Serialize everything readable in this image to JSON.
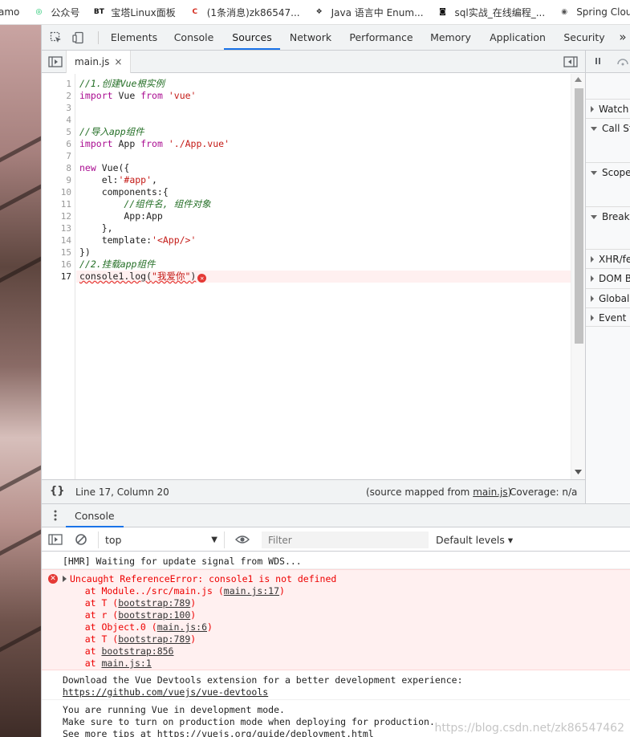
{
  "bookmarks": [
    {
      "label": "amo",
      "icon": "none",
      "icon_text": ""
    },
    {
      "label": "公众号",
      "icon": "wechat-icon",
      "icon_text": "◎",
      "icon_color": "#07c160"
    },
    {
      "label": "宝塔Linux面板",
      "icon": "bt-icon",
      "icon_text": "BT",
      "icon_color": "#111111"
    },
    {
      "label": "(1条消息)zk86547...",
      "icon": "csdn-icon",
      "icon_text": "C",
      "icon_color": "#d42b1e"
    },
    {
      "label": "Java 语言中 Enum...",
      "icon": "site-icon",
      "icon_text": "❖",
      "icon_color": "#333333"
    },
    {
      "label": "sql实战_在线编程_...",
      "icon": "nowcoder-icon",
      "icon_text": "◙",
      "icon_color": "#111111"
    },
    {
      "label": "Spring Clou",
      "icon": "globe-icon",
      "icon_text": "◉",
      "icon_color": "#555555"
    }
  ],
  "devtools": {
    "tabs": [
      "Elements",
      "Console",
      "Sources",
      "Network",
      "Performance",
      "Memory",
      "Application",
      "Security"
    ],
    "active_tab": "Sources",
    "more_tabs": "»"
  },
  "editor": {
    "file_tab": "main.js",
    "close_glyph": "×",
    "line_numbers": [
      "1",
      "2",
      "3",
      "4",
      "5",
      "6",
      "7",
      "8",
      "9",
      "10",
      "11",
      "12",
      "13",
      "14",
      "15",
      "16",
      "17"
    ],
    "current_line": "17",
    "code": {
      "l1": "//1.创建Vue根实例",
      "l2_kw": "import",
      "l2_id": "Vue",
      "l2_from": "from",
      "l2_str": "'vue'",
      "l5": "//导入app组件",
      "l6_kw": "import",
      "l6_id": "App",
      "l6_from": "from",
      "l6_str": "'./App.vue'",
      "l8_kw": "new",
      "l8_rest": "Vue({",
      "l9_key": "    el:",
      "l9_str": "'#app'",
      "l9_end": ",",
      "l10": "    components:{",
      "l11": "        //组件名, 组件对象",
      "l12": "        App:App",
      "l13": "    },",
      "l14_key": "    template:",
      "l14_str": "'<App/>'",
      "l15": "})",
      "l16": "//2.挂载app组件",
      "l17_a": "console1.log(",
      "l17_str": "\"我爱你\"",
      "l17_b": ")"
    }
  },
  "status": {
    "cursor": "Line 17, Column 20",
    "source_mapped_prefix": "(source mapped from ",
    "source_mapped_link": "main.js",
    "source_mapped_suffix": ")",
    "coverage": "Coverage: n/a"
  },
  "debugger": {
    "sections": [
      "Watch",
      "Call Sta",
      "Scope",
      "Breakp",
      "XHR/fe",
      "DOM B",
      "Global",
      "Event L"
    ]
  },
  "drawer": {
    "tab": "Console",
    "context": "top",
    "filter_placeholder": "Filter",
    "levels": "Default levels ▾"
  },
  "console": {
    "hmr": "[HMR] Waiting for update signal from WDS...",
    "error_title": "Uncaught ReferenceError: console1 is not defined",
    "stack": [
      {
        "prefix": "    at Module../src/main.js (",
        "link": "main.js:17",
        "suffix": ")"
      },
      {
        "prefix": "    at T (",
        "link": "bootstrap:789",
        "suffix": ")"
      },
      {
        "prefix": "    at r (",
        "link": "bootstrap:100",
        "suffix": ")"
      },
      {
        "prefix": "    at Object.0 (",
        "link": "main.js:6",
        "suffix": ")"
      },
      {
        "prefix": "    at T (",
        "link": "bootstrap:789",
        "suffix": ")"
      },
      {
        "prefix": "    at ",
        "link": "bootstrap:856",
        "suffix": ""
      },
      {
        "prefix": "    at ",
        "link": "main.js:1",
        "suffix": ""
      }
    ],
    "devtools_msg_1": "Download the Vue Devtools extension for a better development experience:",
    "devtools_msg_2": "https://github.com/vuejs/vue-devtools",
    "dev_mode_1": "You are running Vue in development mode.",
    "dev_mode_2": "Make sure to turn on production mode when deploying for production.",
    "dev_mode_3": "See more tips at https://vuejs.org/guide/deployment.html"
  },
  "watermark": "https://blog.csdn.net/zk86547462"
}
